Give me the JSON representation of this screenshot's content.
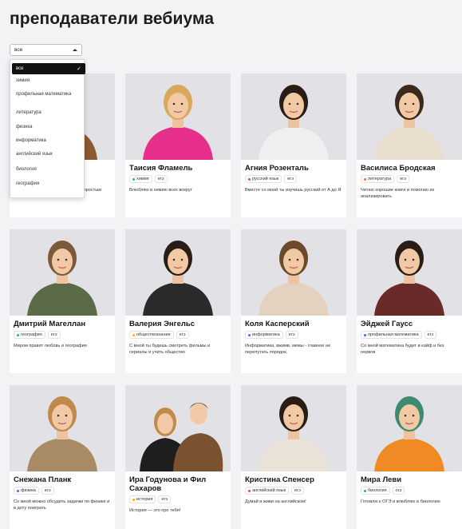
{
  "page": {
    "title": "преподаватели вебиума"
  },
  "filter": {
    "selected": "все",
    "options": [
      "все",
      "химия",
      "профильная математика",
      "литература",
      "физика",
      "информатика",
      "английский язык",
      "биология",
      "география"
    ]
  },
  "teachers": [
    {
      "name": "",
      "subject": "",
      "exam": "",
      "desc": "...ении и объясню сложные вещи простым языком!",
      "color": "#3b6ff3"
    },
    {
      "name": "Таисия Фламель",
      "subject": "химия",
      "exam": "егэ",
      "desc": "Влюбляю в химию всех вокруг",
      "color": "#2bb673"
    },
    {
      "name": "Агния Розенталь",
      "subject": "русский язык",
      "exam": "егэ",
      "desc": "Вместе со мной ты изучишь русский от А до Я",
      "color": "#e5484d"
    },
    {
      "name": "Василиса Бродская",
      "subject": "литература",
      "exam": "егэ",
      "desc": "Читаю хорошие книги и помогаю их анализировать",
      "color": "#f26b3a"
    },
    {
      "name": "Дмитрий Магеллан",
      "subject": "география",
      "exam": "егэ",
      "desc": "Миром правят любовь и география",
      "color": "#2bb673"
    },
    {
      "name": "Валерия Энгельс",
      "subject": "обществознание",
      "exam": "егэ",
      "desc": "С мной ты будешь смотреть фильмы и сериалы и учить общество",
      "color": "#f5b400"
    },
    {
      "name": "Коля Касперский",
      "subject": "информатика",
      "exam": "егэ",
      "desc": "Информатика, вжимв, мемы - главное не перепутать порядок.",
      "color": "#3b6ff3"
    },
    {
      "name": "Эйджей Гаусс",
      "subject": "профильная математика",
      "exam": "егэ",
      "desc": "Со мной математика будет в кайф и без нервов",
      "color": "#3b6ff3"
    },
    {
      "name": "Снежана Планк",
      "subject": "физика",
      "exam": "егэ",
      "desc": "Со мной можно обсудить задачки по физике и в доту поиграть",
      "color": "#3b6ff3"
    },
    {
      "name": "Ира Годунова и Фил Сахаров",
      "subject": "история",
      "exam": "егэ",
      "desc": "История — это про тебя!",
      "color": "#f5b400"
    },
    {
      "name": "Кристина Спенсер",
      "subject": "английский язык",
      "exam": "егэ",
      "desc": "Думай и живи на английском!",
      "color": "#e5484d"
    },
    {
      "name": "Мира Леви",
      "subject": "биология",
      "exam": "огэ",
      "desc": "Готовлю к ОГЭ и влюбляю в биологию",
      "color": "#2bb673"
    }
  ],
  "photo_colors": {
    "bg": "#e2e2e6",
    "shirts": [
      "#8a5a30",
      "#e62f8b",
      "#f0f0f0",
      "#eadfcf",
      "#5c6b47",
      "#2a2a2a",
      "#e3d2c0",
      "#6b2a2a",
      "#a88a64",
      "#6b4a2b",
      "#e9e3d8",
      "#f08a24"
    ],
    "hair": [
      "#6b4a2b",
      "#d9a85a",
      "#2a1d16",
      "#3a2a1e",
      "#7a5a3a",
      "#2a1d16",
      "#6b4a2b",
      "#2a1d16",
      "#c08a4a",
      "#c08a4a",
      "#2a1d16",
      "#3e8a70"
    ]
  }
}
